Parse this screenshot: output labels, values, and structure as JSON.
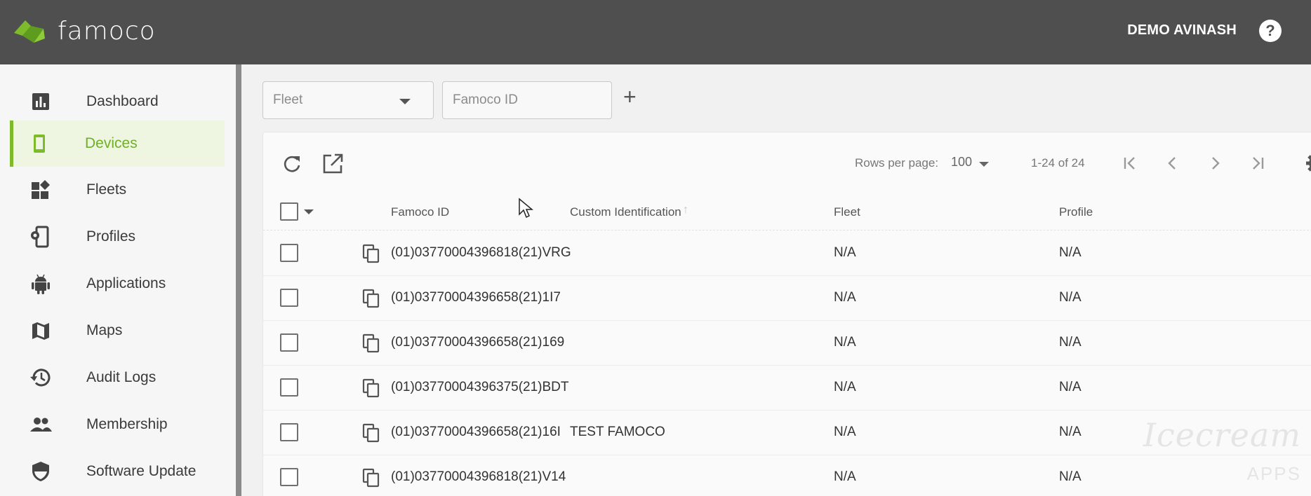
{
  "header": {
    "logo_text": "famoco",
    "user_name": "DEMO AVINASH",
    "help_icon": "help-circle-icon",
    "brand_color": "#7dbb2b",
    "bar_color": "#4f4f4f"
  },
  "sidebar": {
    "items": [
      {
        "label": "Dashboard",
        "icon": "bar-chart-icon"
      },
      {
        "label": "Devices",
        "icon": "smartphone-icon",
        "active": true
      },
      {
        "label": "Fleets",
        "icon": "dashboard-widgets-icon"
      },
      {
        "label": "Profiles",
        "icon": "phone-settings-icon"
      },
      {
        "label": "Applications",
        "icon": "android-icon"
      },
      {
        "label": "Maps",
        "icon": "map-icon"
      },
      {
        "label": "Audit Logs",
        "icon": "history-icon"
      },
      {
        "label": "Membership",
        "icon": "people-icon"
      },
      {
        "label": "Software Update",
        "icon": "shield-icon"
      }
    ]
  },
  "filters": {
    "fleet_placeholder": "Fleet",
    "famoco_id_placeholder": "Famoco ID",
    "add_label": "+"
  },
  "toolbar": {
    "rows_per_page_label": "Rows per page:",
    "rows_per_page_value": "100",
    "range_text": "1-24 of 24"
  },
  "table": {
    "columns": [
      "Famoco ID",
      "Custom Identification",
      "Fleet",
      "Profile"
    ],
    "rows": [
      {
        "famoco_id": "(01)03770004396818(21)VRG",
        "custom": "",
        "fleet": "N/A",
        "profile": "N/A"
      },
      {
        "famoco_id": "(01)03770004396658(21)1I7",
        "custom": "",
        "fleet": "N/A",
        "profile": "N/A"
      },
      {
        "famoco_id": "(01)03770004396658(21)169",
        "custom": "",
        "fleet": "N/A",
        "profile": "N/A"
      },
      {
        "famoco_id": "(01)03770004396375(21)BDT",
        "custom": "",
        "fleet": "N/A",
        "profile": "N/A"
      },
      {
        "famoco_id": "(01)03770004396658(21)16I",
        "custom": "TEST FAMOCO",
        "fleet": "N/A",
        "profile": "N/A"
      },
      {
        "famoco_id": "(01)03770004396818(21)V14",
        "custom": "",
        "fleet": "N/A",
        "profile": "N/A"
      }
    ]
  },
  "watermark": {
    "text": "Icecream",
    "sub": "APPS"
  }
}
